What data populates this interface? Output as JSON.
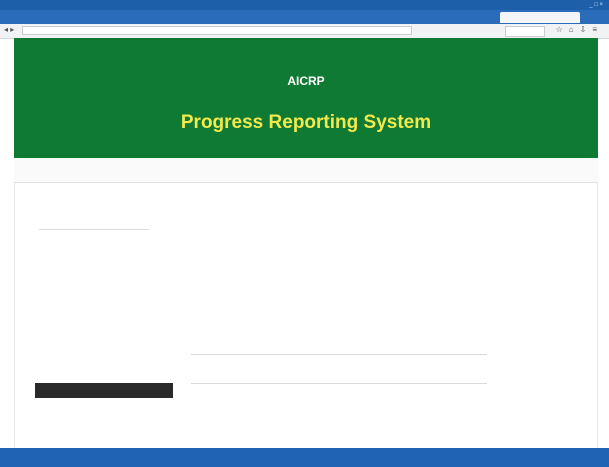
{
  "window": {
    "title_strip": "",
    "minimize_glyph": "_ □ ×"
  },
  "browser": {
    "tabs": [
      {
        "label": "",
        "active": false
      },
      {
        "label": "",
        "active": false
      },
      {
        "label": "",
        "active": false
      },
      {
        "label": "",
        "active": false
      },
      {
        "label": "",
        "active": true
      }
    ],
    "address": ""
  },
  "header": {
    "brand": "AICRP",
    "subtitle": "",
    "title": "Progress Reporting System",
    "bg_color": "#0f7a33",
    "title_color": "#f2e94e"
  },
  "subbar": {
    "home": "",
    "links": ""
  },
  "sidebar": {
    "title": "",
    "items": [
      {
        "label": ""
      },
      {
        "label": ""
      },
      {
        "label": ""
      },
      {
        "label": ""
      },
      {
        "label": ""
      },
      {
        "label": ""
      }
    ],
    "button_label": "",
    "sub_items": [
      {
        "label": ""
      },
      {
        "label": ""
      },
      {
        "label": ""
      }
    ]
  },
  "main": {
    "links": [
      {
        "label": ""
      },
      {
        "label": ""
      },
      {
        "label": ""
      },
      {
        "label": ""
      },
      {
        "label": ""
      },
      {
        "label": ""
      }
    ]
  },
  "taskbar": {
    "start": "",
    "items": [
      "",
      "",
      "",
      "",
      "",
      "",
      ""
    ],
    "tray": ""
  }
}
